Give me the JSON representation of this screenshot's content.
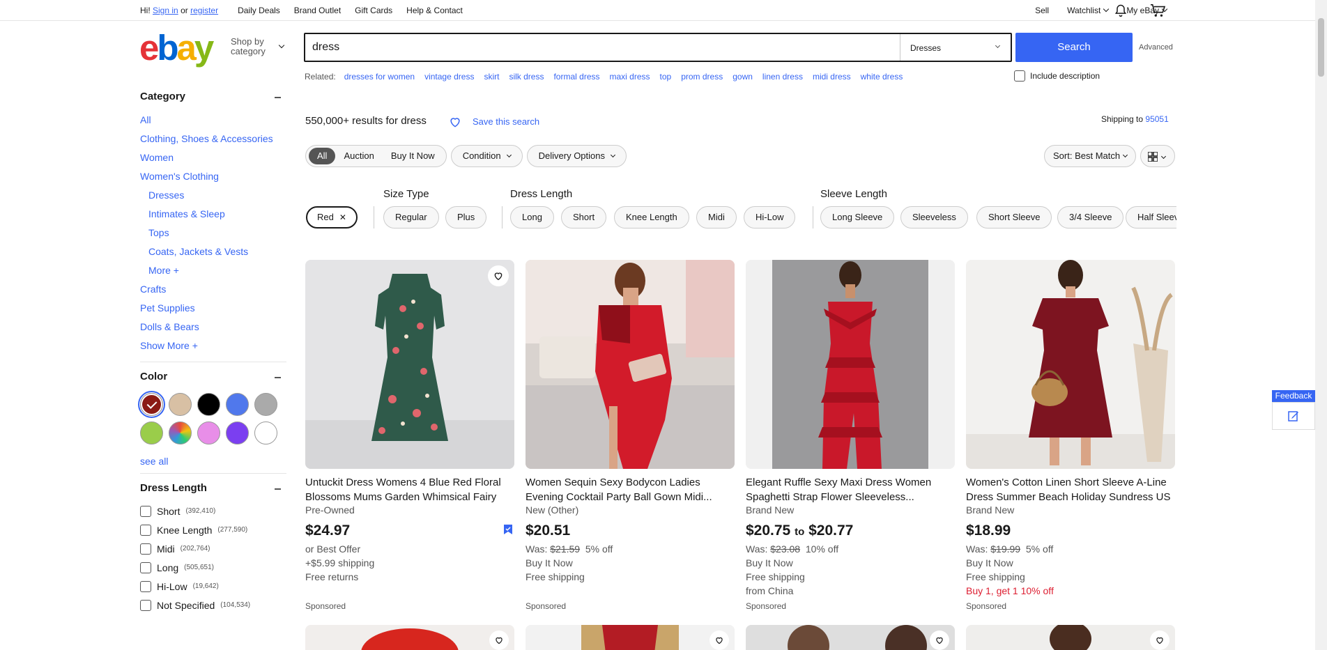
{
  "topnav": {
    "greeting": "Hi!",
    "sign_in": "Sign in",
    "or": "or",
    "register": "register",
    "links": [
      "Daily Deals",
      "Brand Outlet",
      "Gift Cards",
      "Help & Contact"
    ],
    "sell": "Sell",
    "watchlist": "Watchlist",
    "my_ebay": "My eBay"
  },
  "header": {
    "logo": {
      "e": "e",
      "b": "b",
      "a": "a",
      "y": "y"
    },
    "shop_by_1": "Shop by",
    "shop_by_2": "category",
    "search_value": "dress",
    "category_select": "Dresses",
    "search_button": "Search",
    "advanced": "Advanced"
  },
  "related": {
    "label": "Related:",
    "items": [
      "dresses for women",
      "vintage dress",
      "skirt",
      "silk dress",
      "formal dress",
      "maxi dress",
      "top",
      "prom dress",
      "gown",
      "linen dress",
      "midi dress",
      "white dress"
    ],
    "include_description": "Include description"
  },
  "sidebar": {
    "category_title": "Category",
    "category_links": [
      {
        "label": "All",
        "indent": false
      },
      {
        "label": "Clothing, Shoes & Accessories",
        "indent": false
      },
      {
        "label": "Women",
        "indent": false
      },
      {
        "label": "Women's Clothing",
        "indent": false
      },
      {
        "label": "Dresses",
        "indent": true
      },
      {
        "label": "Intimates & Sleep",
        "indent": true
      },
      {
        "label": "Tops",
        "indent": true
      },
      {
        "label": "Coats, Jackets & Vests",
        "indent": true
      },
      {
        "label": "More +",
        "indent": true
      },
      {
        "label": "Crafts",
        "indent": false
      },
      {
        "label": "Pet Supplies",
        "indent": false
      },
      {
        "label": "Dolls & Bears",
        "indent": false
      },
      {
        "label": "Show More +",
        "indent": false
      }
    ],
    "color_title": "Color",
    "colors": [
      {
        "name": "Red",
        "hex": "#8b1a14",
        "selected": true
      },
      {
        "name": "Beige",
        "hex": "#d8c0a4"
      },
      {
        "name": "Black",
        "hex": "#000000"
      },
      {
        "name": "Blue",
        "hex": "#5078ec"
      },
      {
        "name": "Gray",
        "hex": "#aaaaaa"
      },
      {
        "name": "Green",
        "hex": "#9acd4a"
      },
      {
        "name": "Multicolor",
        "hex": "conic-gradient(#e74c3c,#f1c40f,#2ecc71,#3498db,#9b59b6,#e74c3c)"
      },
      {
        "name": "Pink",
        "hex": "#e88ee8"
      },
      {
        "name": "Purple",
        "hex": "#7b3ff0"
      },
      {
        "name": "White",
        "hex": "#ffffff"
      }
    ],
    "see_all": "see all",
    "dress_length_title": "Dress Length",
    "dress_length": [
      {
        "label": "Short",
        "count": "(392,410)"
      },
      {
        "label": "Knee Length",
        "count": "(277,590)"
      },
      {
        "label": "Midi",
        "count": "(202,764)"
      },
      {
        "label": "Long",
        "count": "(505,651)"
      },
      {
        "label": "Hi-Low",
        "count": "(19,642)"
      },
      {
        "label": "Not Specified",
        "count": "(104,534)"
      }
    ]
  },
  "results": {
    "count": "550,000+",
    "results_for": "results for",
    "query": "dress",
    "save_search": "Save this search",
    "shipping_to": "Shipping to",
    "zip": "95051",
    "seg_all": "All",
    "seg_auction": "Auction",
    "seg_bin": "Buy It Now",
    "condition": "Condition",
    "delivery": "Delivery Options",
    "sort": "Sort: Best Match"
  },
  "aspects": {
    "size_type": "Size Type",
    "dress_length": "Dress Length",
    "sleeve_length": "Sleeve Length",
    "selected_chip": "Red",
    "chips_size": [
      "Regular",
      "Plus"
    ],
    "chips_length": [
      "Long",
      "Short",
      "Knee Length",
      "Midi",
      "Hi-Low"
    ],
    "chips_sleeve": [
      "Long Sleeve",
      "Sleeveless",
      "Short Sleeve",
      "3/4 Sleeve",
      "Half Sleeve"
    ]
  },
  "products": [
    {
      "title": "Untuckit Dress Womens 4 Blue Red Floral Blossoms Mums Garden Whimsical Fairy",
      "condition": "Pre-Owned",
      "price": "$24.97",
      "line1": "or Best Offer",
      "line2": "+$5.99 shipping",
      "line3": "Free returns",
      "sponsored": "Sponsored"
    },
    {
      "title": "Women Sequin Sexy Bodycon Ladies Evening Cocktail Party Ball Gown Midi...",
      "condition": "New (Other)",
      "price": "$20.51",
      "was_label": "Was:",
      "was": "$21.59",
      "off": "5% off",
      "line2": "Buy It Now",
      "line3": "Free shipping",
      "sponsored": "Sponsored"
    },
    {
      "title": "Elegant Ruffle Sexy Maxi Dress Women Spaghetti Strap Flower Sleeveless...",
      "condition": "Brand New",
      "price_low": "$20.75",
      "price_to": "to",
      "price_high": "$20.77",
      "was_label": "Was:",
      "was": "$23.08",
      "off": "10% off",
      "line2": "Buy It Now",
      "line3": "Free shipping",
      "line4": "from China",
      "sponsored": "Sponsored"
    },
    {
      "title": "Women's Cotton Linen Short Sleeve A-Line Dress Summer Beach Holiday Sundress US",
      "condition": "Brand New",
      "price": "$18.99",
      "was_label": "Was:",
      "was": "$19.99",
      "off": "5% off",
      "line2": "Buy It Now",
      "line3": "Free shipping",
      "promo": "Buy 1, get 1 10% off",
      "sponsored": "Sponsored"
    }
  ],
  "feedback": "Feedback"
}
